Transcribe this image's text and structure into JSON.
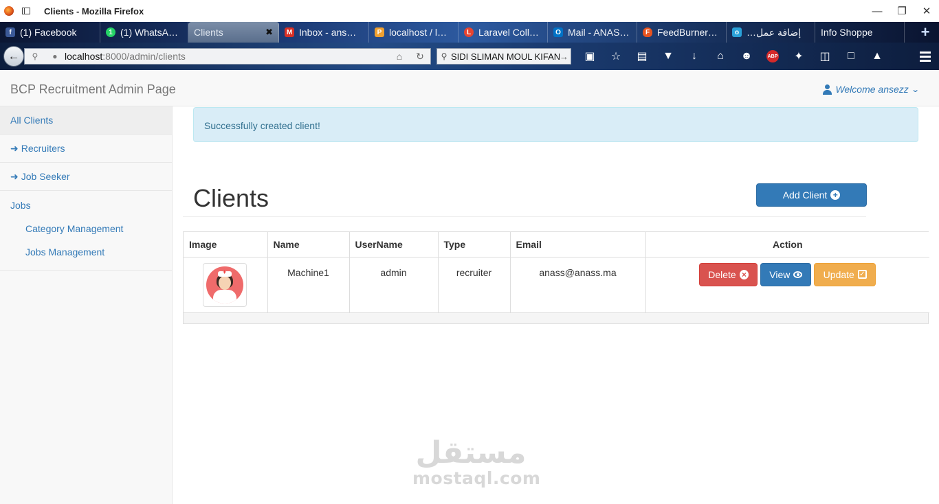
{
  "browser": {
    "window_title": "Clients - Mozilla Firefox",
    "tabs": [
      {
        "label": "(1) Facebook",
        "icon": "facebook-icon",
        "color": "#3b5998",
        "glyph": "f"
      },
      {
        "label": "(1) WhatsA…",
        "icon": "whatsapp-icon",
        "color": "#25d366",
        "glyph": "1"
      },
      {
        "label": "Clients",
        "icon": "",
        "color": "",
        "glyph": "",
        "active": true
      },
      {
        "label": "Inbox - ans…",
        "icon": "gmail-icon",
        "color": "#d93025",
        "glyph": "M"
      },
      {
        "label": "localhost / l…",
        "icon": "phpmyadmin-icon",
        "color": "#f0a030",
        "glyph": "P"
      },
      {
        "label": "Laravel Coll…",
        "icon": "laravel-icon",
        "color": "#e74430",
        "glyph": "L"
      },
      {
        "label": "Mail - ANAS…",
        "icon": "outlook-icon",
        "color": "#0072c6",
        "glyph": "O"
      },
      {
        "label": "FeedBurner…",
        "icon": "feedburner-icon",
        "color": "#e8531f",
        "glyph": "F"
      },
      {
        "label": "…إضافة عمل",
        "icon": "mostaql-icon",
        "color": "#2aa1d9",
        "glyph": "o"
      },
      {
        "label": "Info Shoppe",
        "icon": "",
        "color": "",
        "glyph": ""
      }
    ],
    "url_host": "localhost",
    "url_path": ":8000/admin/clients",
    "search_text": "SIDI SLIMAN MOUL KIFAN"
  },
  "app": {
    "brand": "BCP Recruitment Admin Page",
    "welcome": "Welcome ansezz"
  },
  "sidebar": {
    "all_clients": "All Clients",
    "recruiters": "Recruiters",
    "job_seeker": "Job Seeker",
    "jobs": "Jobs",
    "category_management": "Category Management",
    "jobs_management": "Jobs Management"
  },
  "alert": "Successfully created client!",
  "main": {
    "title": "Clients",
    "add_button": "Add Client"
  },
  "table": {
    "headers": [
      "Image",
      "Name",
      "UserName",
      "Type",
      "Email",
      "Action"
    ],
    "rows": [
      {
        "image": "client-avatar",
        "name": "Machine1",
        "username": "admin",
        "type": "recruiter",
        "email": "anass@anass.ma",
        "actions": {
          "delete": "Delete",
          "view": "View",
          "update": "Update"
        }
      }
    ]
  },
  "watermark": {
    "arabic": "مستقل",
    "latin": "mostaql.com"
  },
  "colors": {
    "primary": "#337ab7",
    "danger": "#d9534f",
    "warning": "#f0ad4e",
    "info_bg": "#d9edf7"
  }
}
